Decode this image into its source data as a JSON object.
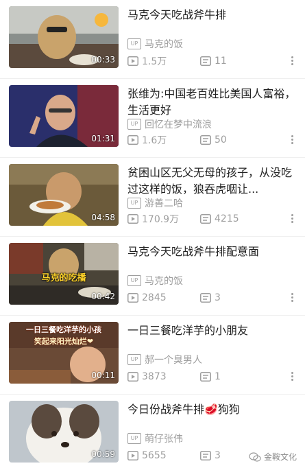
{
  "feed": {
    "items": [
      {
        "title": "马克今天吃战斧牛排",
        "uploader": "马克的饭",
        "views": "1.5万",
        "comments": "11",
        "duration": "00:33"
      },
      {
        "title": "张维为:中国老百姓比美国人富裕，生活更好",
        "uploader": "回忆在梦中流浪",
        "views": "1.6万",
        "comments": "50",
        "duration": "01:31"
      },
      {
        "title": "贫困山区无父无母的孩子，从没吃过这样的饭，狼吞虎咽让...",
        "uploader": "游善二哈",
        "views": "170.9万",
        "comments": "4215",
        "duration": "04:58"
      },
      {
        "title": "马克今天吃战斧牛排配意面",
        "uploader": "马克的饭",
        "views": "2845",
        "comments": "3",
        "duration": "00:42",
        "overlay_text": "马克的吃播"
      },
      {
        "title": "一日三餐吃洋芋的小朋友",
        "uploader": "郝一个臭男人",
        "views": "3873",
        "comments": "1",
        "duration": "00:11",
        "overlay_text_line1": "一日三餐吃洋芋的小孩",
        "overlay_text_line2": "笑起来阳光灿烂❤"
      },
      {
        "title": "今日份战斧牛排🥩狗狗",
        "uploader": "萌仔张伟",
        "views": "5655",
        "comments": "3",
        "duration": "00:59"
      }
    ],
    "up_badge": "UP"
  },
  "watermark": {
    "text": "金鞍文化"
  },
  "icons": {
    "up_badge": "up-badge-icon",
    "views": "play-count-icon",
    "comments": "danmaku-count-icon",
    "more": "more-vertical-icon"
  }
}
